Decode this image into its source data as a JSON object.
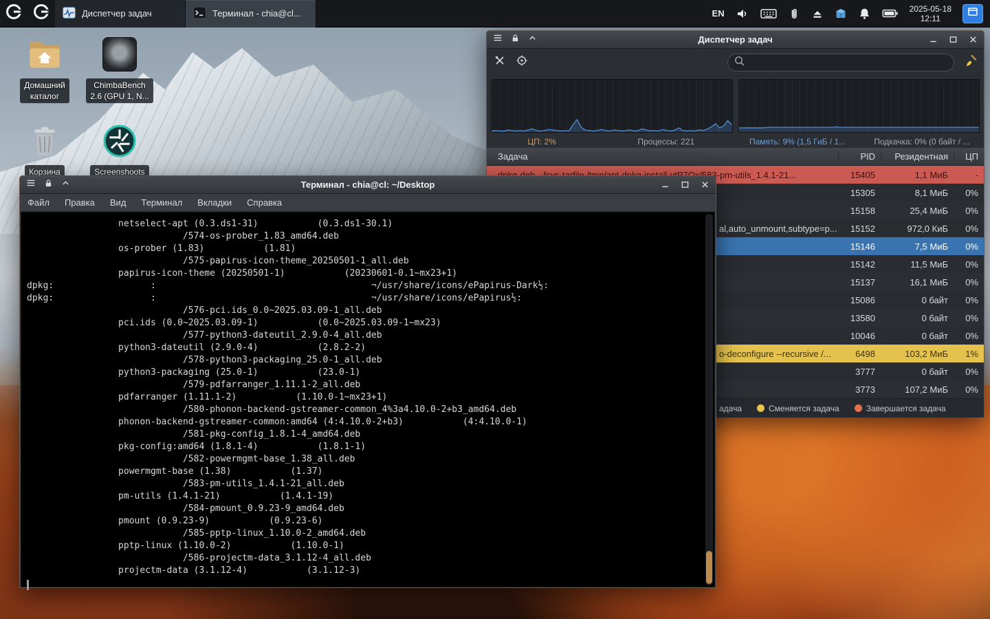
{
  "panel": {
    "taskbar": [
      {
        "icon": "taskmanager-icon",
        "label": "Диспетчер задач"
      },
      {
        "icon": "terminal-icon",
        "label": "Терминал - chia@cl..."
      }
    ],
    "tray": {
      "layout": "EN",
      "icons": [
        "volume-icon",
        "keyboard-icon",
        "clipboard-icon",
        "eject-icon",
        "updates-icon",
        "notifications-icon",
        "battery-icon"
      ],
      "date": "2025-05-18",
      "time": "12:11"
    }
  },
  "desktop": {
    "icons": [
      {
        "name": "home-folder",
        "label_line1": "Домашний",
        "label_line2": "каталог"
      },
      {
        "name": "chimbabench",
        "label_line1": "ChimbaBench",
        "label_line2": "2.6 (GPU 1, N..."
      },
      {
        "name": "trash",
        "label_line1": "Корзина",
        "label_line2": ""
      },
      {
        "name": "screenshots",
        "label_line1": "Screenshoots",
        "label_line2": ""
      }
    ]
  },
  "task_manager": {
    "title": "Диспетчер задач",
    "search_value": "",
    "stats": {
      "cpu": "ЦП: 2%",
      "processes": "Процессы: 221",
      "memory": "Память: 9% (1,5 ГиБ / 1...",
      "swap": "Подкачка: 0% (0 байт / ..."
    },
    "columns": [
      "Задача",
      "PID",
      "Резидентная",
      "ЦП"
    ],
    "rows": [
      {
        "task": "dpkg-deb --fsys-tarfile /tmp/apt-dpkg-install-vtP7Ox/583-pm-utils_1.4.1-21...",
        "pid": "15405",
        "mem": "1,1 МиБ",
        "cpu": "-",
        "state": "red",
        "frag": false
      },
      {
        "task": "",
        "pid": "15305",
        "mem": "8,1 МиБ",
        "cpu": "0%",
        "state": "",
        "frag": false
      },
      {
        "task": "",
        "pid": "15158",
        "mem": "25,4 МиБ",
        "cpu": "0%",
        "state": "",
        "frag": false
      },
      {
        "task": "al,auto_unmount,subtype=p...",
        "pid": "15152",
        "mem": "972,0 КиБ",
        "cpu": "0%",
        "state": "",
        "frag": true
      },
      {
        "task": "",
        "pid": "15146",
        "mem": "7,5 МиБ",
        "cpu": "0%",
        "state": "selected",
        "frag": false
      },
      {
        "task": "",
        "pid": "15142",
        "mem": "11,5 МиБ",
        "cpu": "0%",
        "state": "",
        "frag": false
      },
      {
        "task": "",
        "pid": "15137",
        "mem": "16,1 МиБ",
        "cpu": "0%",
        "state": "",
        "frag": false
      },
      {
        "task": "",
        "pid": "15086",
        "mem": "0 байт",
        "cpu": "0%",
        "state": "",
        "frag": false
      },
      {
        "task": "",
        "pid": "13580",
        "mem": "0 байт",
        "cpu": "0%",
        "state": "",
        "frag": false
      },
      {
        "task": "",
        "pid": "10046",
        "mem": "0 байт",
        "cpu": "0%",
        "state": "",
        "frag": false
      },
      {
        "task": "o-deconfigure --recursive /...",
        "pid": "6498",
        "mem": "103,2 МиБ",
        "cpu": "1%",
        "state": "yellow",
        "frag": true
      },
      {
        "task": "",
        "pid": "3777",
        "mem": "0 байт",
        "cpu": "0%",
        "state": "",
        "frag": false
      },
      {
        "task": "",
        "pid": "3773",
        "mem": "107,2 МиБ",
        "cpu": "0%",
        "state": "",
        "frag": false
      }
    ],
    "legend": [
      {
        "dot": "",
        "label": "адача"
      },
      {
        "dot": "#e8c44a",
        "label": "Сменяется задача"
      },
      {
        "dot": "#e2704a",
        "label": "Завершается задача"
      }
    ],
    "graphs": {
      "color": "#5294e2",
      "cpu_history": [
        2,
        3,
        2,
        2,
        4,
        3,
        2,
        3,
        2,
        4,
        6,
        3,
        2,
        3,
        5,
        4,
        3,
        2,
        3,
        2,
        14,
        24,
        9,
        4,
        3,
        2,
        3,
        5,
        3,
        2,
        4,
        3,
        2,
        3,
        4,
        2,
        3,
        6,
        4,
        2,
        3,
        2,
        5,
        3,
        2,
        4,
        8,
        3,
        2,
        3,
        2,
        4,
        3,
        6,
        10,
        16,
        8,
        12,
        22,
        14
      ],
      "memory_history": [
        8,
        8,
        8,
        8,
        8,
        8,
        8,
        9,
        9,
        9,
        9,
        9,
        9,
        9,
        9,
        9,
        9,
        9,
        9,
        9,
        9,
        9,
        9,
        9,
        10,
        9,
        9,
        9,
        9,
        9,
        9,
        9,
        9,
        9,
        9,
        9,
        9,
        9,
        9,
        9,
        9,
        9,
        9,
        9,
        9,
        9,
        9,
        9,
        9,
        9,
        9,
        9,
        9,
        9,
        9,
        9,
        9,
        9,
        9,
        9
      ]
    }
  },
  "terminal": {
    "title": "Терминал - chia@cl: ~/Desktop",
    "menu": [
      "Файл",
      "Правка",
      "Вид",
      "Терминал",
      "Вкладки",
      "Справка"
    ],
    "lines": [
      "                 netselect-apt (0.3.ds1-31)           (0.3.ds1-30.1)",
      "                             /574-os-prober_1.83_amd64.deb",
      "                 os-prober (1.83)           (1.81)",
      "                             /575-papirus-icon-theme_20250501-1_all.deb",
      "                 papirus-icon-theme (20250501-1)           (20230601-0.1~mx23+1)",
      "dpkg:                  :                                        ¬/usr/share/icons/ePapirus-Dark½:",
      "dpkg:                  :                                        ¬/usr/share/icons/ePapirus½:",
      "                             /576-pci.ids_0.0~2025.03.09-1_all.deb",
      "                 pci.ids (0.0~2025.03.09-1)           (0.0~2025.03.09-1~mx23)",
      "                             /577-python3-dateutil_2.9.0-4_all.deb",
      "                 python3-dateutil (2.9.0-4)           (2.8.2-2)",
      "                             /578-python3-packaging_25.0-1_all.deb",
      "                 python3-packaging (25.0-1)           (23.0-1)",
      "                             /579-pdfarranger_1.11.1-2_all.deb",
      "                 pdfarranger (1.11.1-2)           (1.10.0-1~mx23+1)",
      "                             /580-phonon-backend-gstreamer-common_4%3a4.10.0-2+b3_amd64.deb",
      "                 phonon-backend-gstreamer-common:amd64 (4:4.10.0-2+b3)           (4:4.10.0-1)",
      "                             /581-pkg-config_1.8.1-4_amd64.deb",
      "                 pkg-config:amd64 (1.8.1-4)           (1.8.1-1)",
      "                             /582-powermgmt-base_1.38_all.deb",
      "                 powermgmt-base (1.38)           (1.37)",
      "                             /583-pm-utils_1.4.1-21_all.deb",
      "                 pm-utils (1.4.1-21)           (1.4.1-19)",
      "                             /584-pmount_0.9.23-9_amd64.deb",
      "                 pmount (0.9.23-9)           (0.9.23-6)",
      "                             /585-pptp-linux_1.10.0-2_amd64.deb",
      "                 pptp-linux (1.10.0-2)           (1.10.0-1)",
      "                             /586-projectm-data_3.1.12-4_all.deb",
      "                 projectm-data (3.1.12-4)           (3.1.12-3)"
    ]
  }
}
